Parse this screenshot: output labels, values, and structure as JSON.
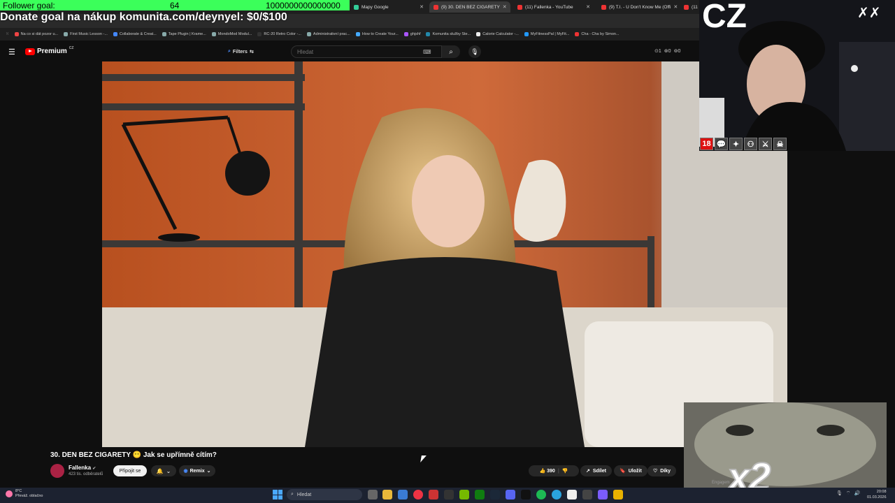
{
  "overlays": {
    "follower_goal_label": "Follower goal:",
    "follower_goal_current": "64",
    "follower_goal_target": "1000000000000000",
    "donate_goal": "Donate goal na nákup komunita.com/deynyel: $0/$100",
    "cam_label": "CZ",
    "cam_badge_age": "18",
    "cat_multiplier": "x2",
    "engage_text": "Engagem"
  },
  "browser": {
    "tabs": [
      {
        "label": "Mapy Google"
      },
      {
        "label": "(9) 30. DEN BEZ CIGARETY"
      },
      {
        "label": "(11) Fallenka - YouTube"
      },
      {
        "label": "(9) T.I. - U Don't Know Me (Offi"
      },
      {
        "label": "(11"
      }
    ],
    "bookmarks": [
      "Na co si dát pozor u...",
      "First Music Lesson -...",
      "Collaborate & Creat...",
      "Tape Plugin | Krame...",
      "MondoMod Modul...",
      "RC-20 Retro Color -...",
      "Administrativní prac...",
      "How to Create Your...",
      "ghjshf",
      "Komunita služby Ste...",
      "Calorie Calculator -...",
      "MyFitnessPal | MyFit...",
      "Cha - Cha by Simon..."
    ]
  },
  "youtube": {
    "logo": "Premium",
    "logo_region": "CZ",
    "filters_label": "Filters",
    "search_placeholder": "Hledat",
    "header_stats": [
      "1",
      "0",
      "0"
    ],
    "video_title": "30. DEN BEZ CIGARETY 😶 Jak se upřímně cítím?",
    "channel_name": "Fallenka",
    "channel_subs": "423 tis. odběratelů",
    "join_label": "Připojit se",
    "remix_label": "Remix",
    "likes": "390",
    "share_label": "Sdílet",
    "save_label": "Uložit",
    "thanks_label": "Díky"
  },
  "taskbar": {
    "weather_temp": "8°C",
    "weather_desc": "Převáž. oblačno",
    "search_label": "Hledat",
    "time": "20:08",
    "date": "01.03.2026"
  }
}
